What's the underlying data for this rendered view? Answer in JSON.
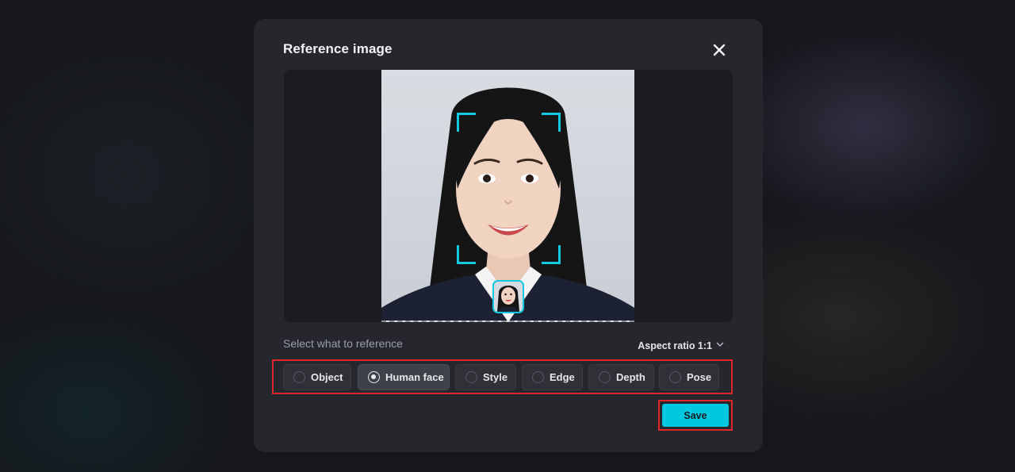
{
  "modal": {
    "title": "Reference image",
    "close_icon": "close-icon"
  },
  "preview": {
    "face_frame_color": "#14c8e0"
  },
  "reference": {
    "prompt": "Select what to reference",
    "aspect_ratio_label": "Aspect ratio 1:1",
    "options": [
      {
        "label": "Object",
        "selected": false
      },
      {
        "label": "Human face",
        "selected": true
      },
      {
        "label": "Style",
        "selected": false
      },
      {
        "label": "Edge",
        "selected": false
      },
      {
        "label": "Depth",
        "selected": false
      },
      {
        "label": "Pose",
        "selected": false
      }
    ]
  },
  "actions": {
    "save_label": "Save"
  },
  "colors": {
    "accent": "#00c8e0",
    "highlight": "#e0262b",
    "modal_bg": "#25272c"
  }
}
